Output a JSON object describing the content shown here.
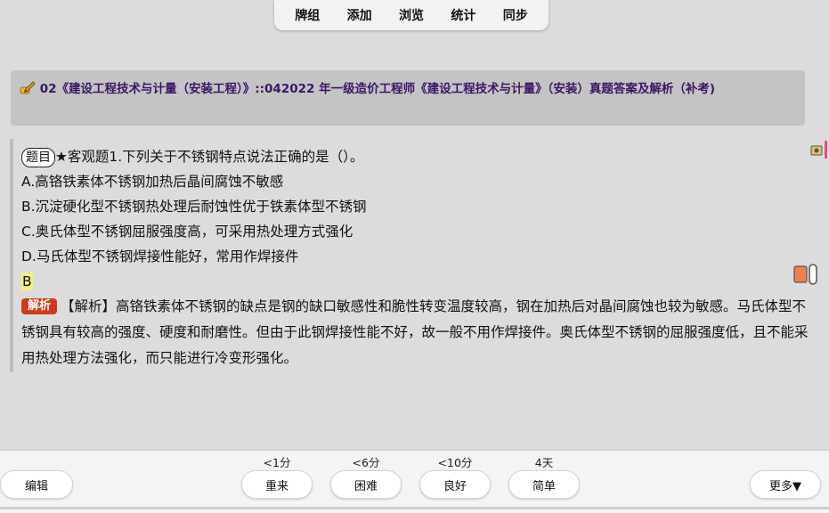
{
  "topnav": {
    "items": [
      {
        "label": "牌组"
      },
      {
        "label": "添加"
      },
      {
        "label": "浏览"
      },
      {
        "label": "统计"
      },
      {
        "label": "同步"
      }
    ]
  },
  "deck": {
    "title": "02《建设工程技术与计量（安装工程）》::042022 年一级造价工程师《建设工程技术与计量》（安装）真题答案及解析（补考)"
  },
  "card": {
    "tag": "题目",
    "question": "★客观题1.下列关于不锈钢特点说法正确的是（）。",
    "options": [
      "A.高铬铁素体不锈钢加热后晶间腐蚀不敏感",
      "B.沉淀硬化型不锈钢热处理后耐蚀性优于铁素体型不锈钢",
      "C.奥氏体型不锈钢屈服强度高，可采用热处理方式强化",
      "D.马氏体型不锈钢焊接性能好，常用作焊接件"
    ],
    "answer": "B",
    "analysis_tag": "解析",
    "analysis": "【解析】高铬铁素体不锈钢的缺点是钢的缺口敏感性和脆性转变温度较高，钢在加热后对晶间腐蚀也较为敏感。马氏体型不锈钢具有较高的强度、硬度和耐磨性。但由于此钢焊接性能不好，故一般不用作焊接件。奥氏体型不锈钢的屈服强度低，且不能采用热处理方法强化，而只能进行冷变形强化。"
  },
  "bottom": {
    "edit_label": "编辑",
    "more_label": "更多▼",
    "answers": [
      {
        "interval": "<1分",
        "label": "重来"
      },
      {
        "interval": "<6分",
        "label": "困难"
      },
      {
        "interval": "<10分",
        "label": "良好"
      },
      {
        "interval": "4天",
        "label": "简单"
      }
    ]
  },
  "icons": {
    "deck_icon": "pencil-hand-icon",
    "flag_icon": "card-info-icon",
    "audio_icon": "toggle-icon"
  },
  "colors": {
    "header_text": "#3a1665",
    "analysis_badge": "#cf3a1e",
    "answer_highlight": "#f5ee80"
  }
}
